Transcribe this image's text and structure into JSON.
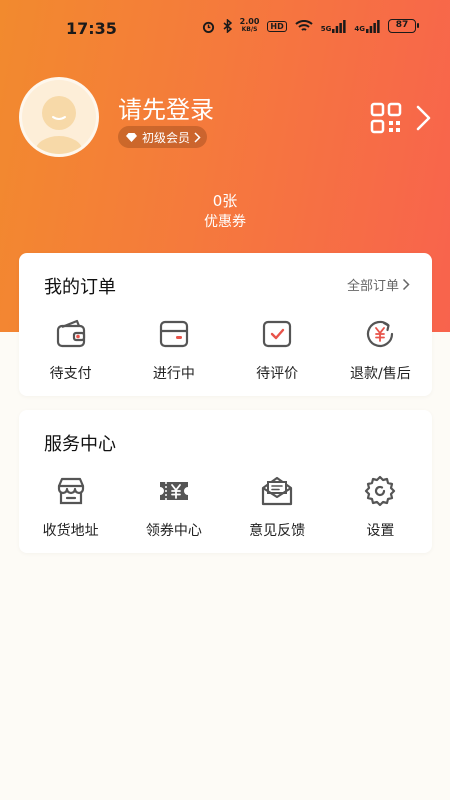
{
  "status_bar": {
    "time": "17:35",
    "net_speed_value": "2.00",
    "net_speed_unit": "KB/S",
    "hd": "HD",
    "signal1_label": "5G",
    "signal2_label": "4G",
    "battery": "87"
  },
  "profile": {
    "login_prompt": "请先登录",
    "member_level": "初级会员"
  },
  "coupons": {
    "count": "0张",
    "label": "优惠券"
  },
  "orders": {
    "title": "我的订单",
    "all_link": "全部订单",
    "items": [
      {
        "label": "待支付",
        "icon": "wallet-icon"
      },
      {
        "label": "进行中",
        "icon": "card-icon"
      },
      {
        "label": "待评价",
        "icon": "review-check-icon"
      },
      {
        "label": "退款/售后",
        "icon": "refund-yen-icon"
      }
    ]
  },
  "services": {
    "title": "服务中心",
    "items": [
      {
        "label": "收货地址",
        "icon": "store-address-icon"
      },
      {
        "label": "领券中心",
        "icon": "coupon-ticket-icon"
      },
      {
        "label": "意见反馈",
        "icon": "feedback-mail-icon"
      },
      {
        "label": "设置",
        "icon": "settings-gear-icon"
      }
    ]
  },
  "colors": {
    "gradient_start": "#f28a2e",
    "gradient_end": "#f8634d",
    "accent_red": "#e8534a",
    "icon_gray": "#555555",
    "page_bg": "#fdfbf6"
  }
}
